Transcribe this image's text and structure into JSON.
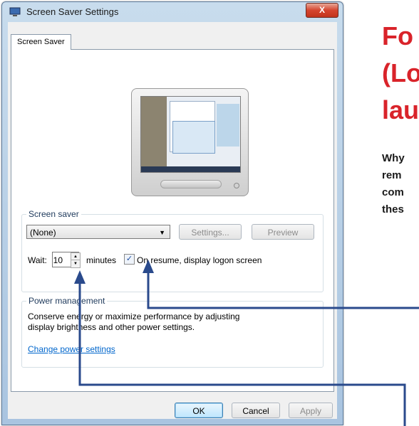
{
  "window": {
    "title": "Screen Saver Settings",
    "close_label": "X",
    "tab_label": "Screen Saver"
  },
  "screen_saver": {
    "group_label": "Screen saver",
    "selected_option": "(None)",
    "settings_label": "Settings...",
    "preview_label": "Preview",
    "wait_label": "Wait:",
    "wait_value": "10",
    "minutes_label": "minutes",
    "resume_checked": true,
    "resume_label": "On resume, display logon screen"
  },
  "power": {
    "group_label": "Power management",
    "description_line1": "Conserve energy or maximize performance by adjusting",
    "description_line2": "display brightness and other power settings.",
    "link_label": "Change power settings"
  },
  "footer": {
    "ok_label": "OK",
    "cancel_label": "Cancel",
    "apply_label": "Apply"
  },
  "article": {
    "headline_lines": [
      "Fo",
      "(Lo",
      "lau"
    ],
    "body_lines": [
      "Why",
      "rem",
      "com",
      "thes"
    ]
  },
  "colors": {
    "headline": "#d9232a",
    "arrow": "#2a4a8c",
    "link": "#0066cc"
  }
}
